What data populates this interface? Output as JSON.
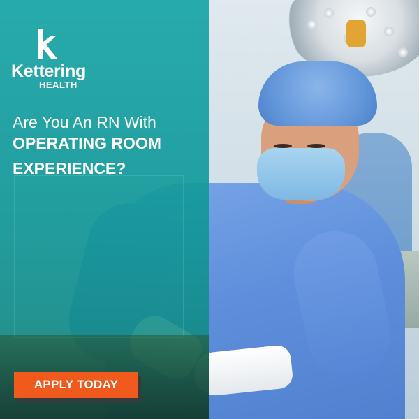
{
  "brand": {
    "name": "Kettering",
    "sub": "HEALTH",
    "logo_icon": "kettering-k-icon"
  },
  "headline": {
    "line1": "Are You An RN With",
    "line2": "OPERATING ROOM",
    "line3": "EXPERIENCE?"
  },
  "cta": {
    "label": "APPLY TODAY"
  },
  "colors": {
    "panel": "#1aa6a6",
    "cta": "#f15a1d",
    "gown": "#5f8fdc",
    "text": "#ffffff"
  }
}
